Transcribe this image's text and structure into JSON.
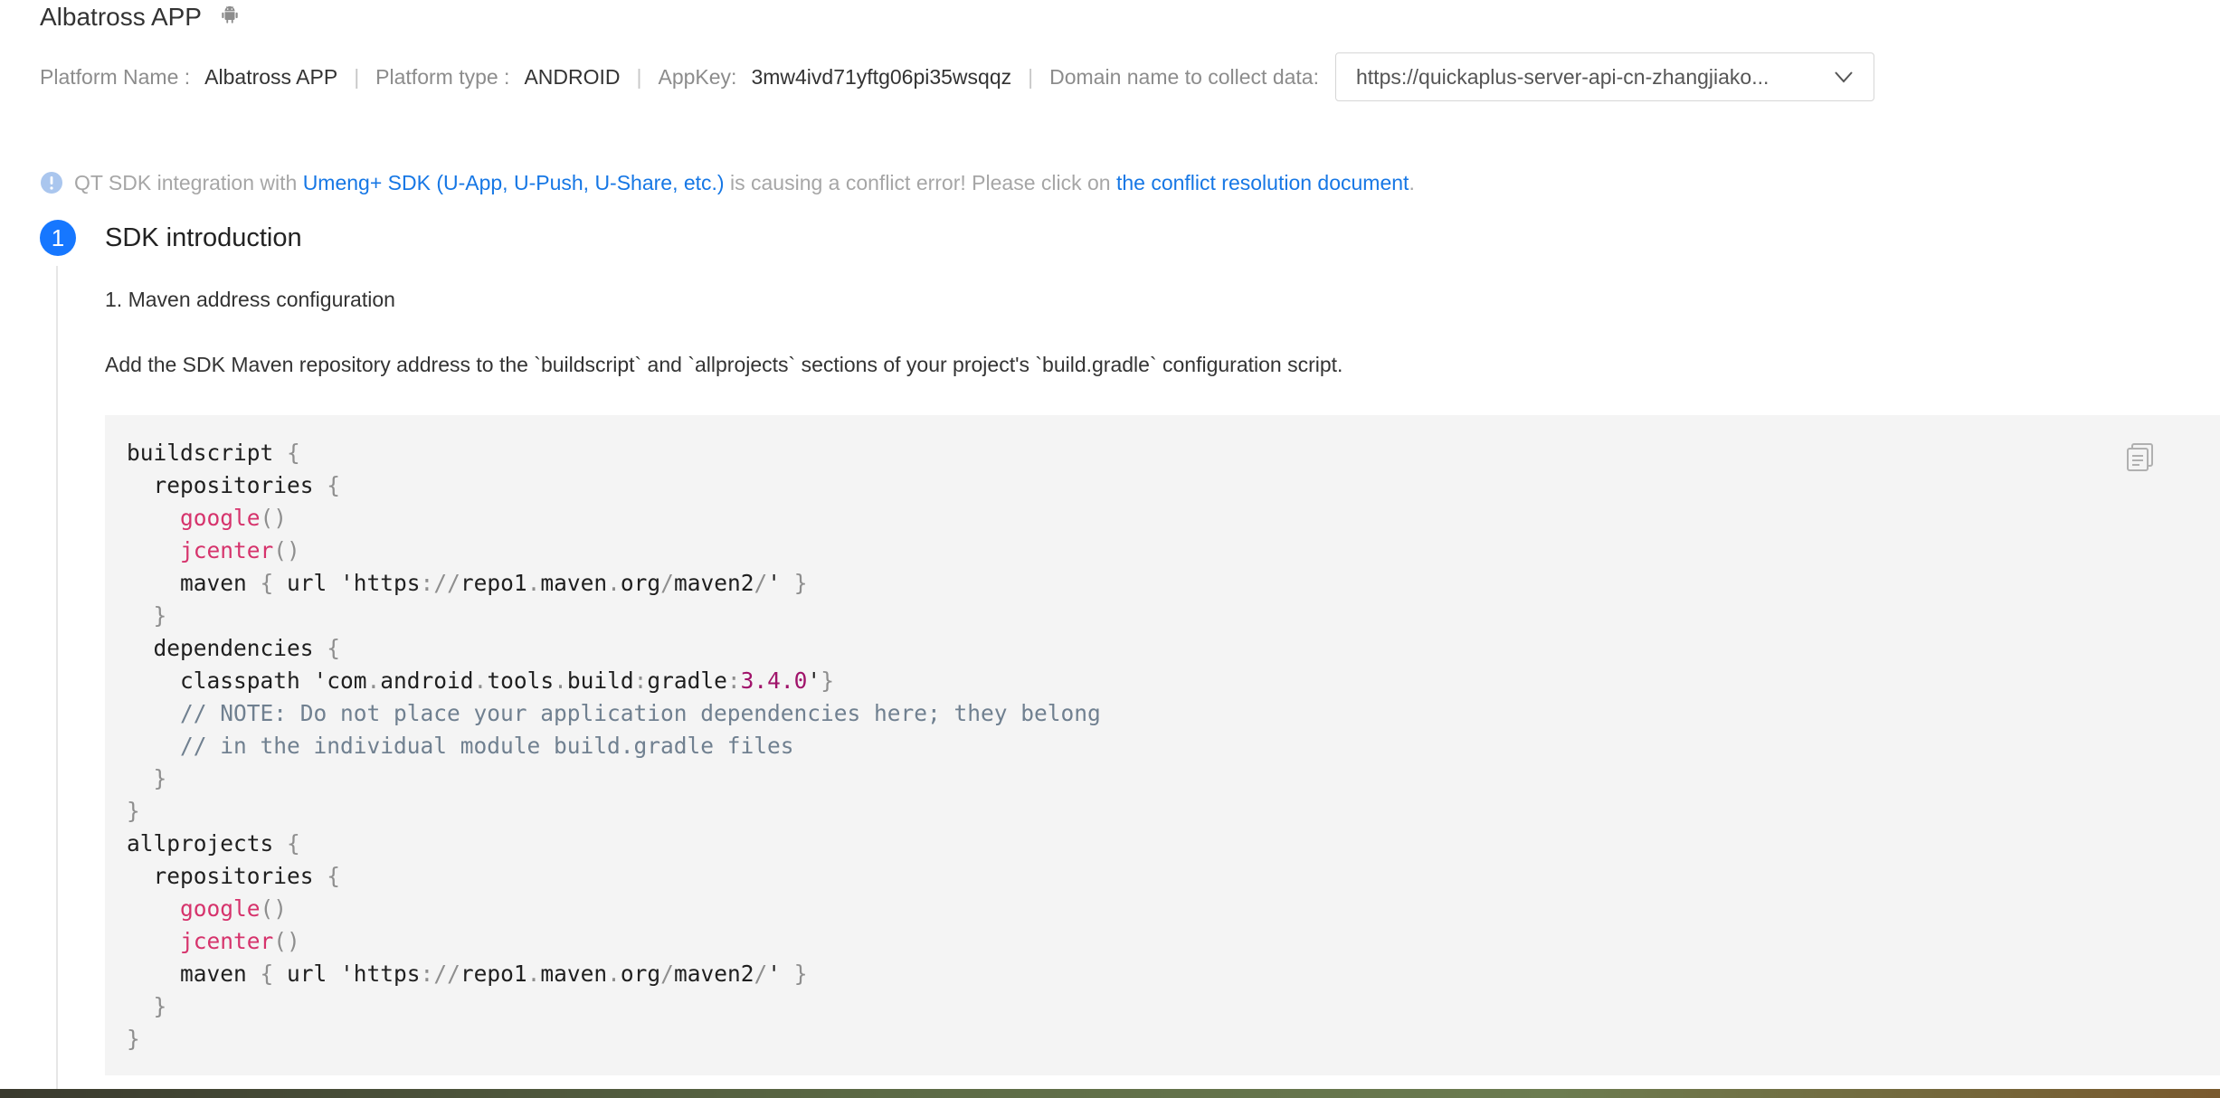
{
  "header": {
    "app_title": "Albatross APP",
    "platform_icon": "android-icon"
  },
  "info": {
    "platform_name_label": "Platform Name :",
    "platform_name_value": "Albatross APP",
    "platform_type_label": "Platform type :",
    "platform_type_value": "ANDROID",
    "appkey_label": "AppKey:",
    "appkey_value": "3mw4ivd71yftg06pi35wsqqz",
    "domain_label": "Domain name to collect data:",
    "domain_value": "https://quickaplus-server-api-cn-zhangjiako...",
    "separator": "|"
  },
  "notice": {
    "icon": "info-icon",
    "text_1": "QT SDK integration with",
    "link_1": "Umeng+ SDK (U-App, U-Push, U-Share, etc.)",
    "text_2": "is causing a conflict error! Please click on",
    "link_2": "the conflict resolution document",
    "text_3": "."
  },
  "step": {
    "number": "1",
    "title": "SDK introduction",
    "subtitle": "1. Maven address configuration",
    "description": "Add the SDK Maven repository address to the `buildscript` and `allprojects` sections of your project's `build.gradle` configuration script."
  },
  "code": {
    "copy_icon": "copy-icon",
    "lines": [
      "buildscript {",
      "  repositories {",
      "    google()",
      "    jcenter()",
      "    maven { url 'https://repo1.maven.org/maven2/' }",
      "  }",
      "  dependencies {",
      "    classpath 'com.android.tools.build:gradle:3.4.0'}",
      "    // NOTE: Do not place your application dependencies here; they belong",
      "    // in the individual module build.gradle files",
      "  }",
      "}",
      "allprojects {",
      "  repositories {",
      "    google()",
      "    jcenter()",
      "    maven { url 'https://repo1.maven.org/maven2/' }",
      "  }",
      "}"
    ]
  },
  "colors": {
    "accent": "#1677ff",
    "link": "#1677e5",
    "code_background": "#f4f4f4",
    "code_function": "#d6336c",
    "code_comment": "#708090",
    "code_number": "#a0136a"
  }
}
